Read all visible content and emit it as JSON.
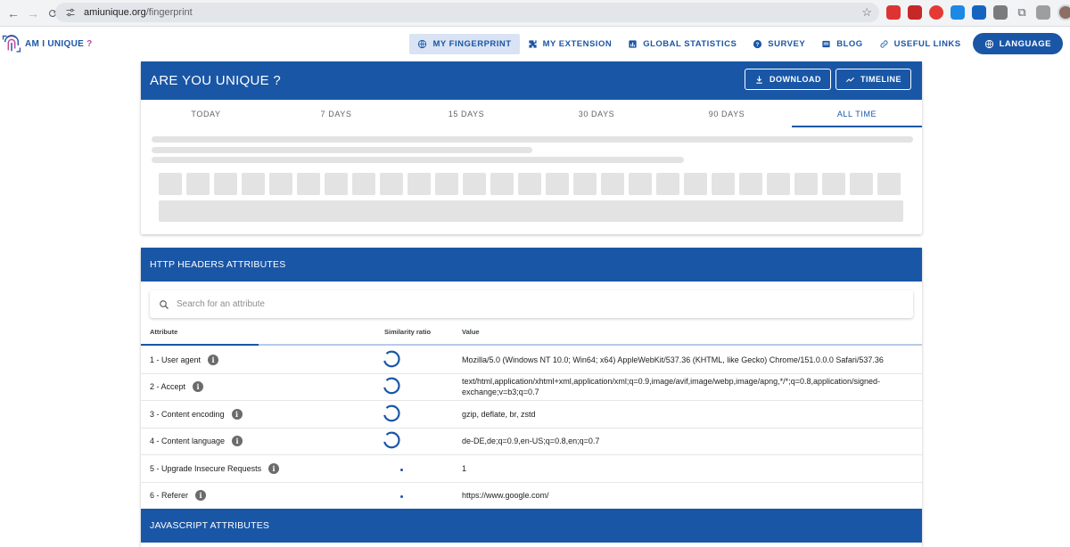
{
  "browser": {
    "url_host": "amiunique.org",
    "url_path": "/fingerprint"
  },
  "site": {
    "logo_main": "AM I UNIQUE ",
    "logo_accent": "?",
    "nav": [
      {
        "label": "MY FINGERPRINT",
        "icon": "globe-icon",
        "active": true
      },
      {
        "label": "MY EXTENSION",
        "icon": "puzzle-icon",
        "active": false
      },
      {
        "label": "GLOBAL STATISTICS",
        "icon": "chart-icon",
        "active": false
      },
      {
        "label": "SURVEY",
        "icon": "help-circle-icon",
        "active": false
      },
      {
        "label": "BLOG",
        "icon": "book-icon",
        "active": false
      },
      {
        "label": "USEFUL LINKS",
        "icon": "link-icon",
        "active": false
      }
    ],
    "language_label": "LANGUAGE"
  },
  "unique_card": {
    "title": "ARE YOU UNIQUE ?",
    "download_label": "DOWNLOAD",
    "timeline_label": "TIMELINE",
    "tabs": [
      "TODAY",
      "7 DAYS",
      "15 DAYS",
      "30 DAYS",
      "90 DAYS",
      "ALL TIME"
    ],
    "active_tab": "ALL TIME"
  },
  "http_card": {
    "title": "HTTP HEADERS ATTRIBUTES",
    "search_placeholder": "Search for an attribute",
    "col_attribute": "Attribute",
    "col_similarity": "Similarity ratio",
    "col_value": "Value",
    "rows": [
      {
        "attribute": "1 - User agent",
        "value": "Mozilla/5.0 (Windows NT 10.0; Win64; x64) AppleWebKit/537.36 (KHTML, like Gecko) Chrome/151.0.0.0 Safari/537.36",
        "ratio_state": "loading"
      },
      {
        "attribute": "2 - Accept",
        "value": "text/html,application/xhtml+xml,application/xml;q=0.9,image/avif,image/webp,image/apng,*/*;q=0.8,application/signed-exchange;v=b3;q=0.7",
        "ratio_state": "loading"
      },
      {
        "attribute": "3 - Content encoding",
        "value": "gzip, deflate, br, zstd",
        "ratio_state": "loading"
      },
      {
        "attribute": "4 - Content language",
        "value": "de-DE,de;q=0.9,en-US;q=0.8,en;q=0.7",
        "ratio_state": "loading"
      },
      {
        "attribute": "5 - Upgrade Insecure Requests",
        "value": "1",
        "ratio_state": "dot"
      },
      {
        "attribute": "6 - Referer",
        "value": "https://www.google.com/",
        "ratio_state": "dot"
      }
    ]
  },
  "js_card": {
    "title": "JAVASCRIPT ATTRIBUTES"
  },
  "colors": {
    "primary": "#1a56a6",
    "accent": "#c2459b",
    "active_nav_bg": "#d9e3f3",
    "skeleton": "#e3e3e3"
  }
}
